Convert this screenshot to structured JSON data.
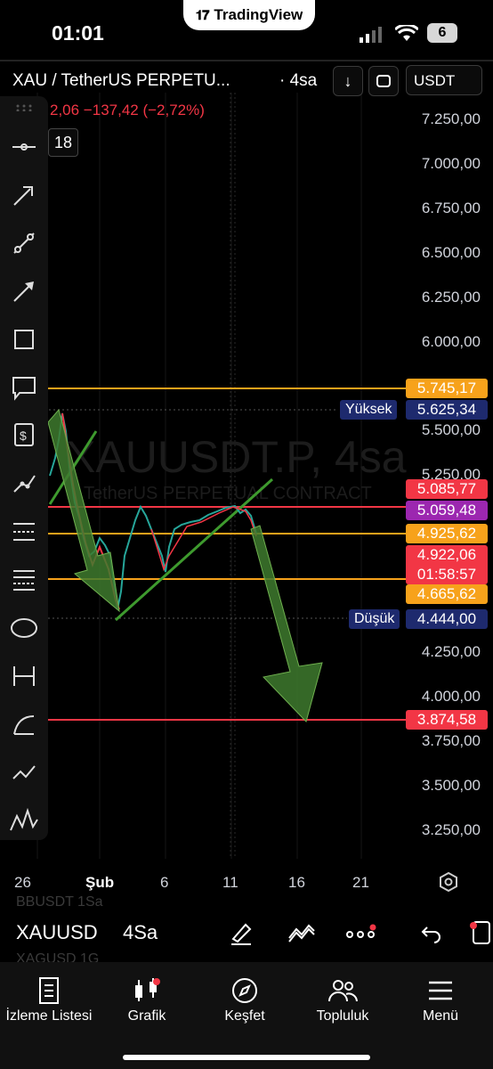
{
  "status": {
    "time": "01:01",
    "app_pill": "TradingView",
    "battery": "6"
  },
  "header": {
    "symbol": "XAU / TetherUS PERPETU...",
    "interval": "· 4sa",
    "currency": "USDT",
    "change": "2,06 −137,42 (−2,72%)",
    "count": "18"
  },
  "watermark": {
    "symbol": "XAUUSDT.P, 4sa",
    "description": "TetherUS PERPETUAL CONTRACT"
  },
  "price_axis": [
    "7.250,00",
    "7.000,00",
    "6.750,00",
    "6.500,00",
    "6.250,00",
    "6.000,00",
    "5.500,00",
    "5.250,00",
    "4.250,00",
    "4.000,00",
    "3.750,00",
    "3.500,00",
    "3.250,00"
  ],
  "price_labels": {
    "level_orange_top": "5.745,17",
    "high_tag": "Yüksek",
    "high": "5.625,34",
    "level_red": "5.085,77",
    "level_purple": "5.059,48",
    "level_orange_mid": "4.925,62",
    "last_price": "4.922,06",
    "countdown": "01:58:57",
    "level_orange_low": "4.665,62",
    "low_tag": "Düşük",
    "low": "4.444,00",
    "target": "3.874,58"
  },
  "time_axis": [
    "26",
    "Şub",
    "6",
    "11",
    "16",
    "21"
  ],
  "bottom_bar": {
    "symbol": "XAUUSD",
    "interval": "4Sa",
    "ghost_top": "BBUSDT  1Sa",
    "ghost_bottom": "XAGUSD  1G"
  },
  "tabs": [
    "İzleme Listesi",
    "Grafik",
    "Keşfet",
    "Topluluk",
    "Menü"
  ],
  "colors": {
    "up": "#26a69a",
    "down": "#f23645",
    "orange": "#f7a21b",
    "purple": "#9c27b0",
    "navy": "#1e2a6e",
    "arrow": "#3e7a2e"
  }
}
